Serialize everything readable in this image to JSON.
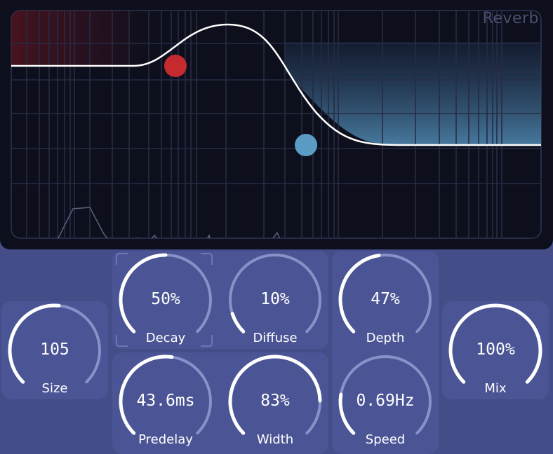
{
  "title": "Reverb",
  "colors": {
    "background": "#444d88",
    "card": "#4b5595",
    "display": "#0d0f1c",
    "grid": "#272b45",
    "curve": "#ffffff",
    "low_handle": "#c42a2e",
    "high_handle": "#5b9cc4",
    "arc_track": "#8891c8",
    "arc_value": "#ffffff"
  },
  "display": {
    "curve_description": "filter-curve",
    "handles": [
      {
        "name": "low-band-handle",
        "color": "#c42a2e"
      },
      {
        "name": "high-band-handle",
        "color": "#5b9cc4"
      }
    ]
  },
  "knobs": {
    "size": {
      "label": "Size",
      "value": "105",
      "fraction": 0.52
    },
    "decay": {
      "label": "Decay",
      "value": "50%",
      "fraction": 0.5
    },
    "diffuse": {
      "label": "Diffuse",
      "value": "10%",
      "fraction": 0.1
    },
    "depth": {
      "label": "Depth",
      "value": "47%",
      "fraction": 0.47
    },
    "mix": {
      "label": "Mix",
      "value": "100%",
      "fraction": 1.0
    },
    "predelay": {
      "label": "Predelay",
      "value": "43.6ms",
      "fraction": 0.53
    },
    "width": {
      "label": "Width",
      "value": "83%",
      "fraction": 0.83
    },
    "speed": {
      "label": "Speed",
      "value": "0.69Hz",
      "fraction": 0.2
    }
  }
}
